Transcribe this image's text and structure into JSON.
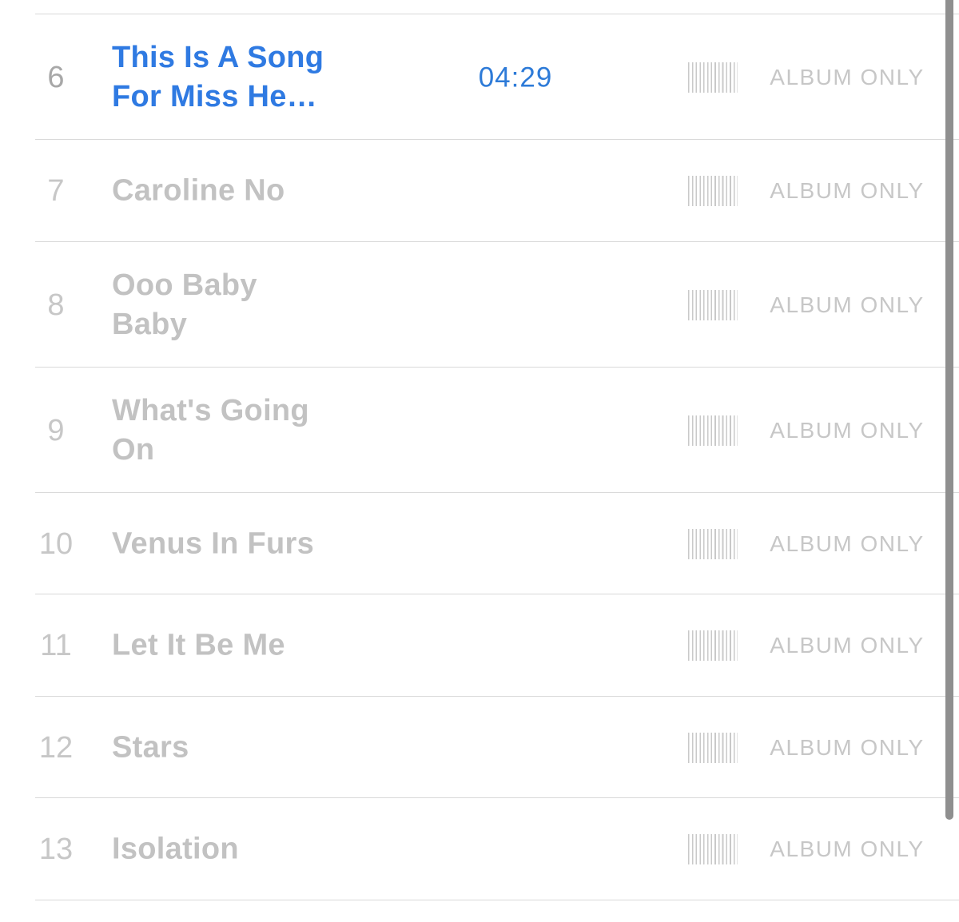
{
  "tracks": [
    {
      "number": "6",
      "title": "This Is A Song For Miss He…",
      "duration": "04:29",
      "status": "ALBUM ONLY",
      "active": true
    },
    {
      "number": "7",
      "title": "Caroline No",
      "duration": "",
      "status": "ALBUM ONLY",
      "active": false
    },
    {
      "number": "8",
      "title": "Ooo Baby Baby",
      "duration": "",
      "status": "ALBUM ONLY",
      "active": false
    },
    {
      "number": "9",
      "title": "What's Going On",
      "duration": "",
      "status": "ALBUM ONLY",
      "active": false
    },
    {
      "number": "10",
      "title": "Venus In Furs",
      "duration": "",
      "status": "ALBUM ONLY",
      "active": false
    },
    {
      "number": "11",
      "title": "Let It Be Me",
      "duration": "",
      "status": "ALBUM ONLY",
      "active": false
    },
    {
      "number": "12",
      "title": "Stars",
      "duration": "",
      "status": "ALBUM ONLY",
      "active": false
    },
    {
      "number": "13",
      "title": "Isolation",
      "duration": "",
      "status": "ALBUM ONLY",
      "active": false
    }
  ],
  "icons": {
    "preview": "waveform-icon"
  },
  "colors": {
    "accent": "#2f7ae2",
    "inactive_text": "#c2c2c2",
    "divider": "#d9d9d9"
  }
}
